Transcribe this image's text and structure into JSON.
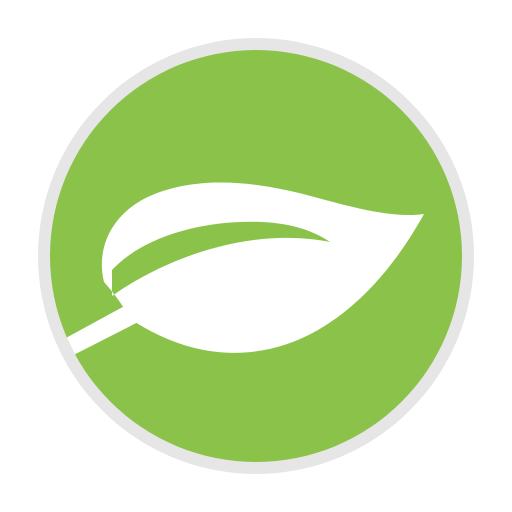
{
  "icon": {
    "name": "leaf-icon",
    "colors": {
      "background": "#ffffff",
      "ring": "#e6e6e6",
      "circle_fill": "#8bc34a",
      "leaf": "#ffffff"
    }
  }
}
